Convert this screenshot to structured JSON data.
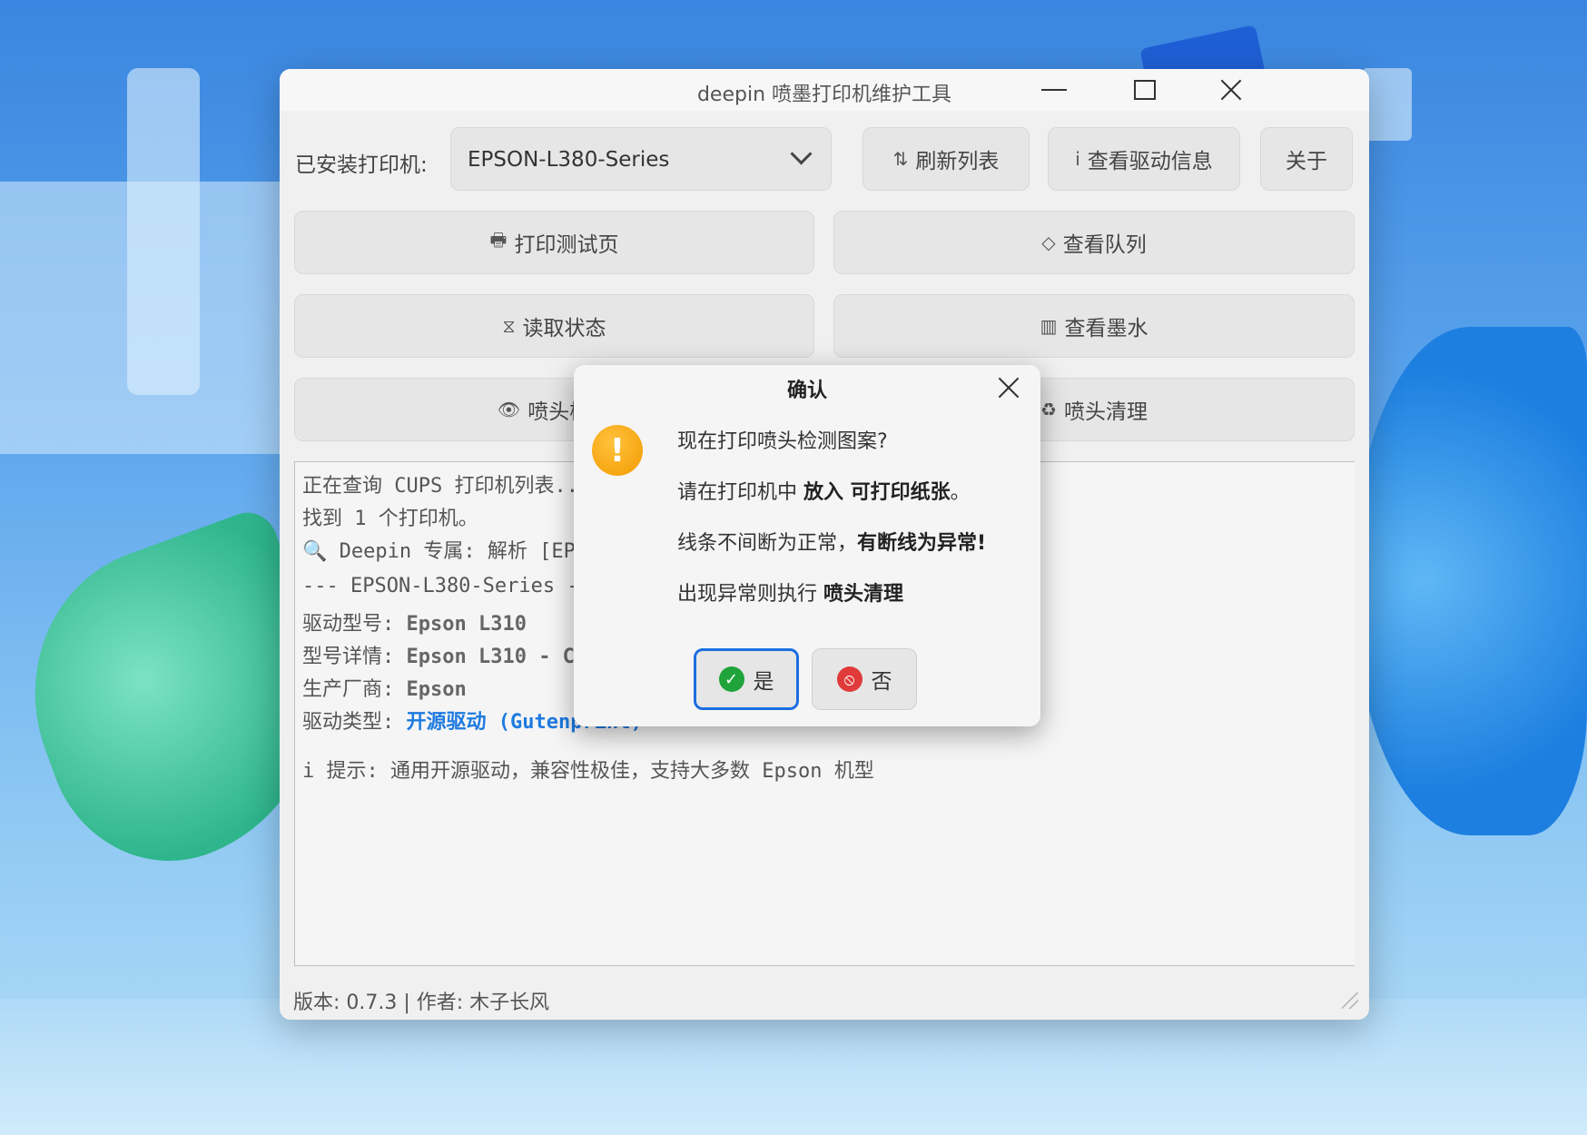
{
  "window": {
    "title": "deepin 喷墨打印机维护工具"
  },
  "toolbar": {
    "installed_label": "已安装打印机:",
    "printer_selected": "EPSON-L380-Series",
    "refresh_label": "刷新列表",
    "driver_info_label": "查看驱动信息",
    "about_label": "关于"
  },
  "actions": {
    "print_test_label": "打印测试页",
    "view_queue_label": "查看队列",
    "read_status_label": "读取状态",
    "view_ink_label": "查看墨水",
    "nozzle_check_label": "喷头检测",
    "nozzle_clean_label": "喷头清理"
  },
  "log": {
    "l1": "正在查询 CUPS 打印机列表...",
    "l2": "找到 1 个打印机。",
    "l3": "🔍 Deepin 专属: 解析 [EPSON-L380-Series]",
    "l4": "--- EPSON-L380-Series ---",
    "l5_key": "驱动型号: ",
    "l5_val": "Epson L310",
    "l6_key": "型号详情: ",
    "l6_val": "Epson L310 - CUPS+Gutenprint",
    "l7_key": "生产厂商: ",
    "l7_val": "Epson",
    "l8_key": "驱动类型: ",
    "l8_val": "开源驱动 (Gutenprint)",
    "l9": "i 提示: 通用开源驱动，兼容性极佳，支持大多数 Epson 机型"
  },
  "status": {
    "text": "版本: 0.7.3 | 作者: 木子长风"
  },
  "dialog": {
    "title": "确认",
    "line1": "现在打印喷头检测图案?",
    "line2_a": "请在打印机中 ",
    "line2_b": "放入 可打印纸张",
    "line2_c": "。",
    "line3_a": "线条不间断为正常，",
    "line3_b": "有断线为异常!",
    "line4_a": "出现异常则执行 ",
    "line4_b": "喷头清理",
    "yes_label": "是",
    "no_label": "否"
  }
}
